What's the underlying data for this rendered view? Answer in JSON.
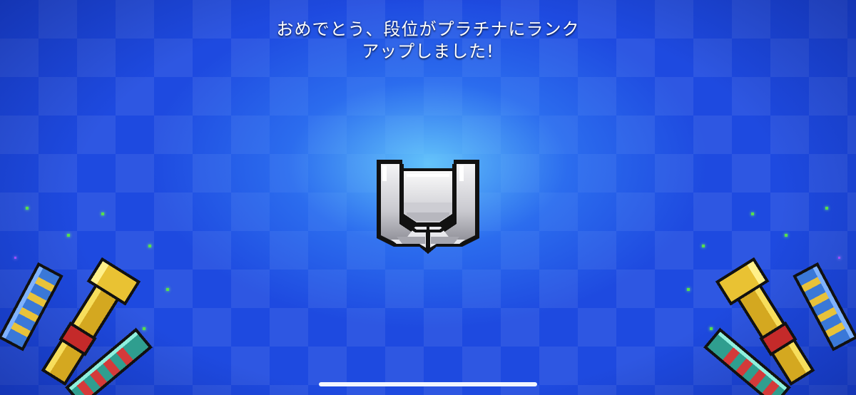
{
  "message": {
    "line1": "おめでとう、段位がプラチナにランク",
    "line2": "アップしました!"
  },
  "rank_badge": {
    "icon": "platinum-rank-badge-icon",
    "colors": {
      "silver_light": "#ffffff",
      "silver_mid": "#cfcfd4",
      "silver_dark": "#8e8e96",
      "outline": "#111111"
    }
  },
  "background": {
    "pattern": "blue checkerboard",
    "base_color": "#1e4ae0",
    "glow_color": "#6ed7ff"
  },
  "decorations": {
    "left_weapon": "golden-blaster-icon",
    "right_weapon": "golden-blaster-icon",
    "sparkle_color": "#57e04a"
  }
}
